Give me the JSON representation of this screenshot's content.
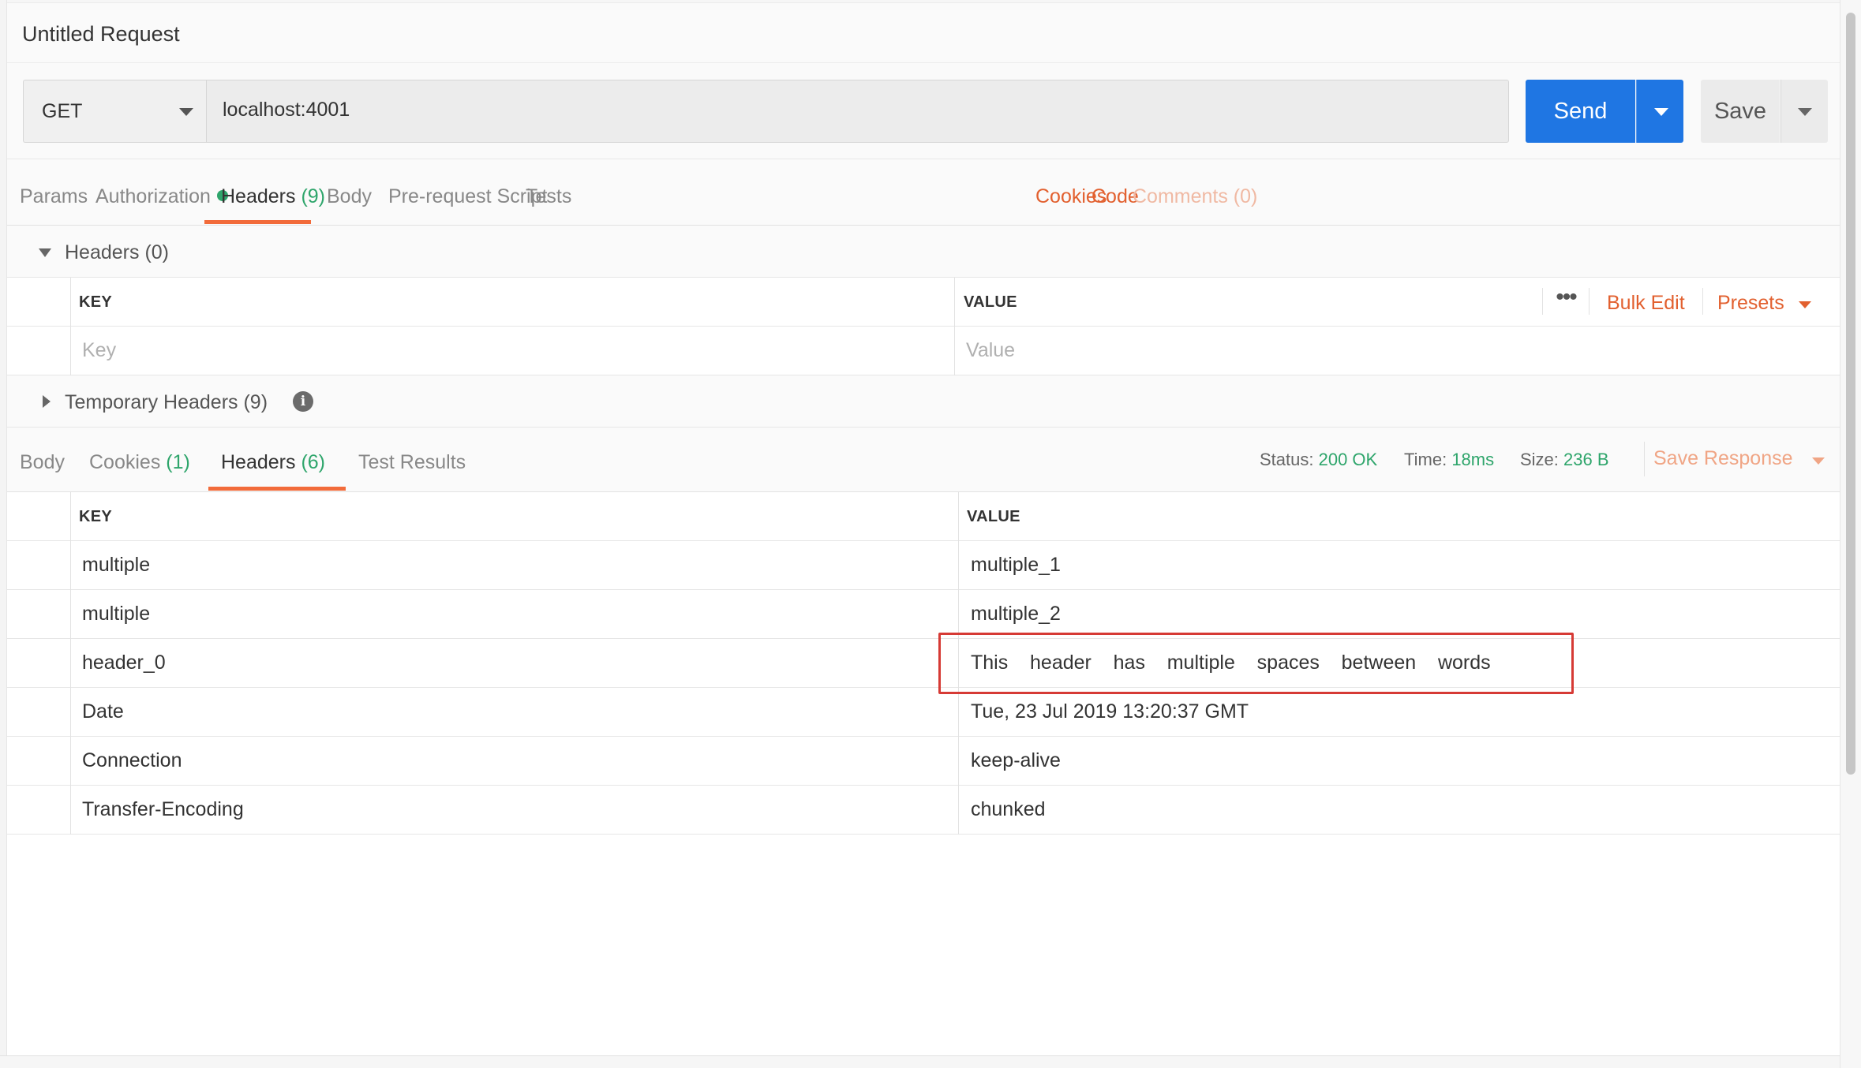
{
  "request": {
    "title": "Untitled Request",
    "method": "GET",
    "url": "localhost:4001",
    "send_label": "Send",
    "save_label": "Save"
  },
  "request_tabs": {
    "params": "Params",
    "authorization": "Authorization",
    "headers": "Headers",
    "headers_count": "(9)",
    "body": "Body",
    "prerequest": "Pre-request Script",
    "tests": "Tests",
    "cookies": "Cookies",
    "code": "Code",
    "comments": "Comments (0)"
  },
  "request_headers": {
    "section_title": "Headers (0)",
    "key_col": "KEY",
    "value_col": "VALUE",
    "key_placeholder": "Key",
    "value_placeholder": "Value",
    "more_icon": "•••",
    "bulk_edit": "Bulk Edit",
    "presets": "Presets"
  },
  "temporary_headers": {
    "title": "Temporary Headers (9)",
    "info_icon": "i"
  },
  "response_tabs": {
    "body": "Body",
    "cookies": "Cookies",
    "cookies_count": "(1)",
    "headers": "Headers",
    "headers_count": "(6)",
    "test_results": "Test Results"
  },
  "response_status": {
    "status_label": "Status:",
    "status_value": "200 OK",
    "time_label": "Time:",
    "time_value": "18ms",
    "size_label": "Size:",
    "size_value": "236 B",
    "save_response": "Save Response"
  },
  "response_headers": {
    "key_col": "KEY",
    "value_col": "VALUE",
    "rows": [
      {
        "key": "multiple",
        "value": "multiple_1"
      },
      {
        "key": "multiple",
        "value": "multiple_2"
      },
      {
        "key": "header_0",
        "value": "This    header    has    multiple    spaces    between    words"
      },
      {
        "key": "Date",
        "value": "Tue, 23 Jul 2019 13:20:37 GMT"
      },
      {
        "key": "Connection",
        "value": "keep-alive"
      },
      {
        "key": "Transfer-Encoding",
        "value": "chunked"
      }
    ]
  },
  "colors": {
    "accent": "#f26b3a",
    "send_blue": "#1f76e3",
    "status_green": "#2ea56b",
    "highlight_red": "#d63a35"
  }
}
